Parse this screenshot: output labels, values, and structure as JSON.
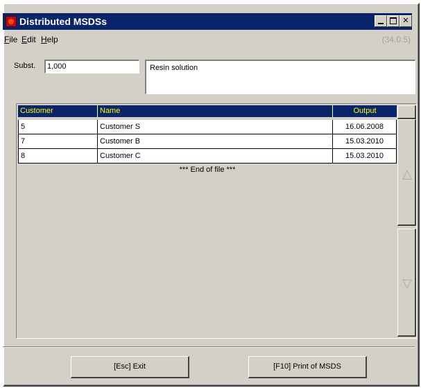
{
  "window": {
    "title": "Distributed MSDSs",
    "controls": {
      "minimize": "_",
      "maximize": "□",
      "close": "✕"
    }
  },
  "menu": {
    "items": [
      "File",
      "Edit",
      "Help"
    ],
    "accelerators": [
      "F",
      "E",
      "H"
    ],
    "version": "(34.0.5)"
  },
  "form": {
    "subst_label": "Subst.",
    "subst_value": "1,000",
    "description": "Resin solution"
  },
  "table": {
    "columns": [
      "Customer",
      "Name",
      "Output"
    ],
    "rows": [
      {
        "customer": "5",
        "name": "Customer S",
        "output": "16.06.2008"
      },
      {
        "customer": "7",
        "name": "Customer B",
        "output": "15.03.2010"
      },
      {
        "customer": "8",
        "name": "Customer C",
        "output": "15.03.2010"
      }
    ],
    "end_text": "*** End of file ***"
  },
  "scroll": {
    "up_icon": "triangle-up-icon",
    "down_icon": "triangle-down-icon"
  },
  "buttons": {
    "exit": "[Esc] Exit",
    "print": "[F10] Print of MSDS"
  },
  "colors": {
    "titlebar": "#0a246a",
    "header_text": "#ffff00",
    "face": "#d4d0c8"
  }
}
